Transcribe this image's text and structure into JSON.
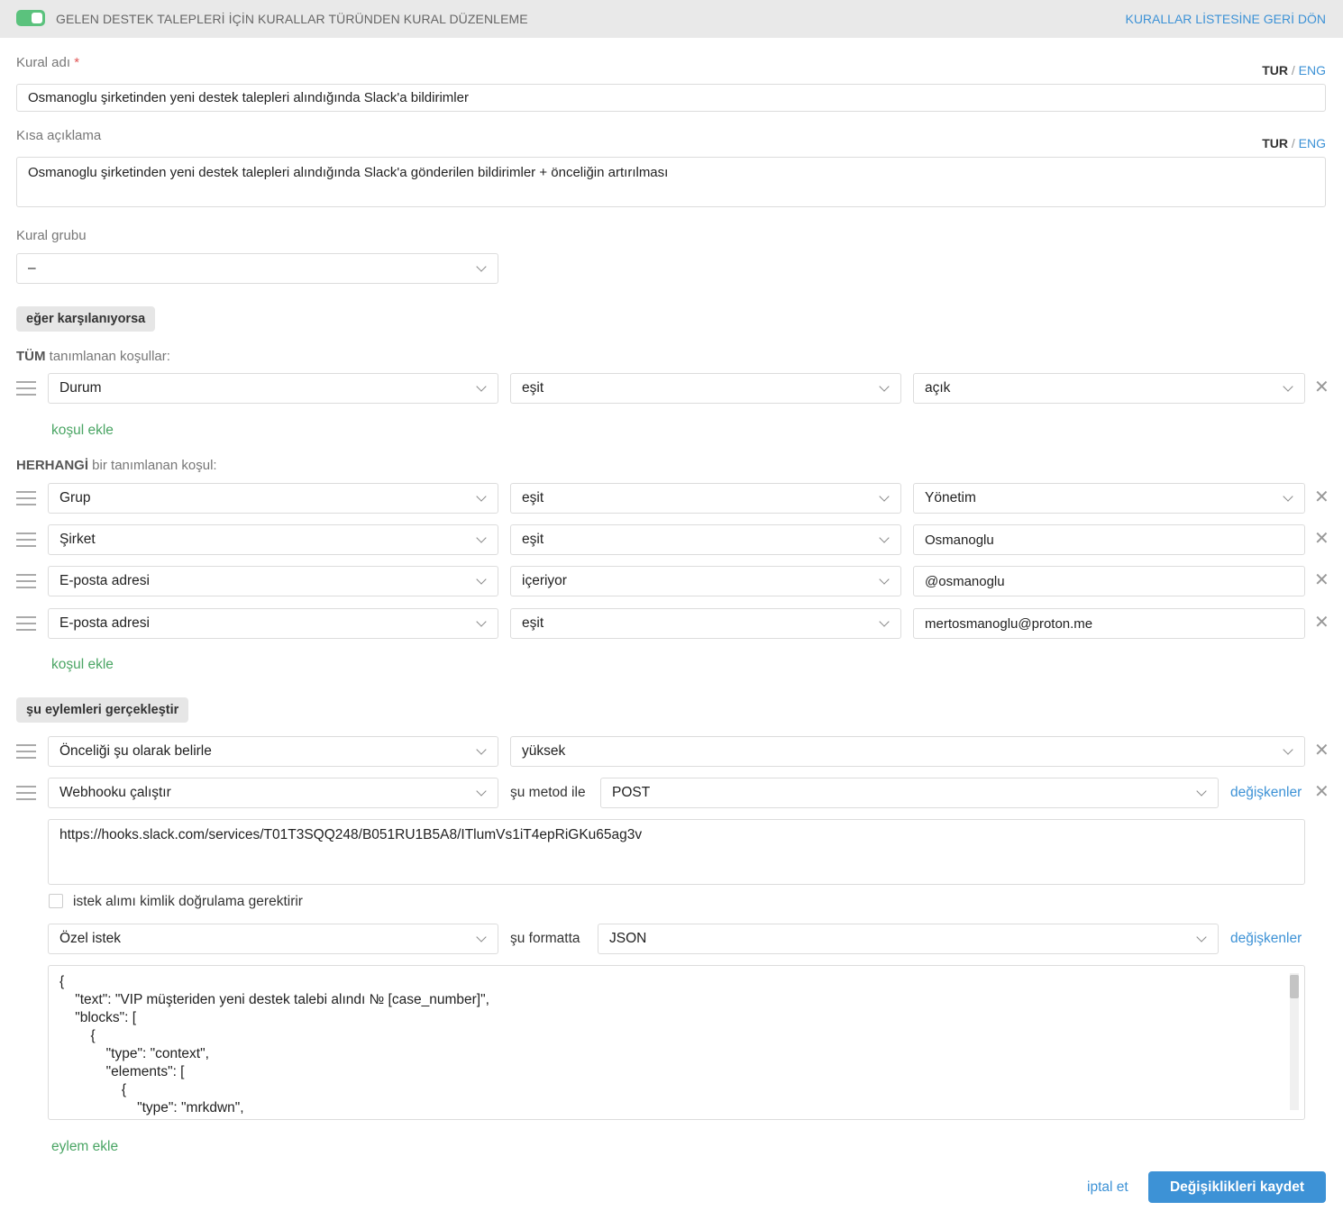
{
  "header": {
    "title": "GELEN DESTEK TALEPLERİ İÇİN KURALLAR TÜRÜNDEN KURAL DÜZENLEME",
    "back_link": "KURALLAR LİSTESİNE GERİ DÖN",
    "toggle_on": true
  },
  "lang": {
    "tur": "TUR",
    "sep": " / ",
    "eng": "ENG"
  },
  "rule_name": {
    "label": "Kural adı",
    "required_mark": "*",
    "value": "Osmanoglu şirketinden yeni destek talepleri alındığında Slack'a bildirimler"
  },
  "short_desc": {
    "label": "Kısa açıklama",
    "value": "Osmanoglu şirketinden yeni destek talepleri alındığında Slack'a gönderilen bildirimler + önceliğin artırılması"
  },
  "rule_group": {
    "label": "Kural grubu",
    "value": "–"
  },
  "if_section": {
    "label": "eğer karşılanıyorsa"
  },
  "all_conditions": {
    "title_bold": "TÜM",
    "title_rest": " tanımlanan koşullar:",
    "rows": [
      {
        "field": "Durum",
        "operator": "eşit",
        "value": "açık"
      }
    ],
    "add_label": "koşul ekle"
  },
  "any_conditions": {
    "title_bold": "HERHANGİ",
    "title_rest": " bir tanımlanan koşul:",
    "rows": [
      {
        "field": "Grup",
        "operator": "eşit",
        "value": "Yönetim"
      },
      {
        "field": "Şirket",
        "operator": "eşit",
        "value": "Osmanoglu"
      },
      {
        "field": "E-posta adresi",
        "operator": "içeriyor",
        "value": "@osmanoglu"
      },
      {
        "field": "E-posta adresi",
        "operator": "eşit",
        "value": "mertosmanoglu@proton.me"
      }
    ],
    "add_label": "koşul ekle"
  },
  "actions_section": {
    "label": "şu eylemleri gerçekleştir"
  },
  "actions": {
    "priority": {
      "action": "Önceliği şu olarak belirle",
      "value": "yüksek"
    },
    "webhook": {
      "action": "Webhooku çalıştır",
      "method_label": "şu metod ile",
      "method": "POST",
      "variables_label": "değişkenler",
      "url": "https://hooks.slack.com/services/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",
      "auth_label": "istek alımı kimlik doğrulama gerektirir",
      "auth_checked": false,
      "request_type": "Özel istek",
      "format_label": "şu formatta",
      "format": "JSON",
      "variables_label2": "değişkenler",
      "body": "{\n    \"text\": \"VIP müşteriden yeni destek talebi alındı № [case_number]\",\n    \"blocks\": [\n        {\n            \"type\": \"context\",\n            \"elements\": [\n                {\n                    \"type\": \"mrkdwn\","
    },
    "add_label": "eylem ekle"
  },
  "footer": {
    "cancel": "iptal et",
    "save": "Değişiklikleri kaydet"
  },
  "colors": {
    "accent": "#3d92d6",
    "green": "#4aa564",
    "toggle": "#5bc27d"
  }
}
